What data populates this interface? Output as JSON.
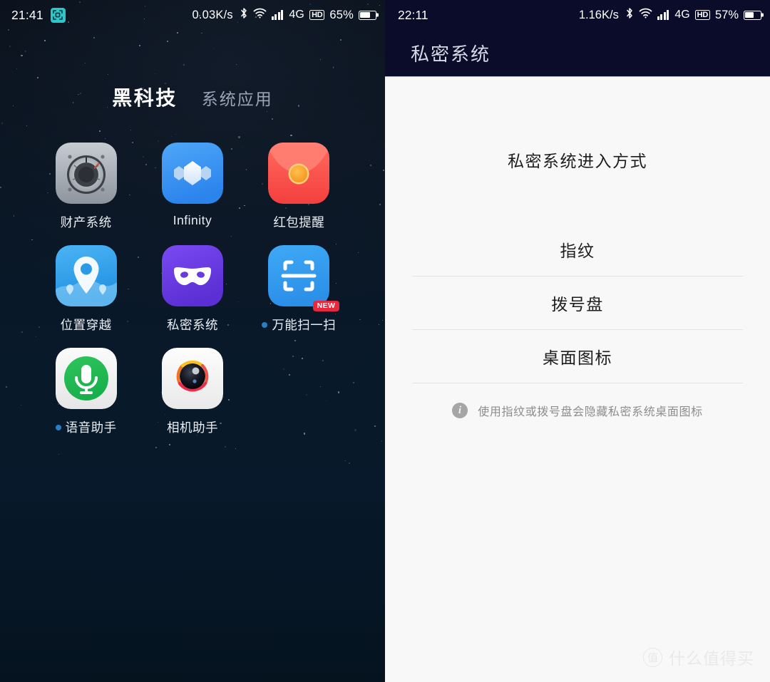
{
  "left_phone": {
    "statusbar": {
      "time": "21:41",
      "screenshot_icon": "screenshot-icon",
      "net_speed": "0.03K/s",
      "bluetooth_icon": "bluetooth-icon",
      "wifi_icon": "wifi-icon",
      "signal_icon": "signal-bars-icon",
      "network": "4G",
      "hd": "HD",
      "battery_pct": "65%",
      "battery_level": 65
    },
    "tabs": [
      {
        "label": "黑科技",
        "active": true
      },
      {
        "label": "系统应用",
        "active": false
      }
    ],
    "apps": [
      {
        "label": "财产系统",
        "icon": "compass-gauge-icon",
        "dot": false,
        "badge": null
      },
      {
        "label": "Infinity",
        "icon": "infinity-hexagon-icon",
        "dot": false,
        "badge": null
      },
      {
        "label": "红包提醒",
        "icon": "red-packet-icon",
        "dot": false,
        "badge": null
      },
      {
        "label": "位置穿越",
        "icon": "location-pin-icon",
        "dot": false,
        "badge": null
      },
      {
        "label": "私密系统",
        "icon": "mask-icon",
        "dot": false,
        "badge": null
      },
      {
        "label": "万能扫一扫",
        "icon": "scan-frame-icon",
        "dot": true,
        "badge": "NEW"
      },
      {
        "label": "语音助手",
        "icon": "microphone-icon",
        "dot": true,
        "badge": null
      },
      {
        "label": "相机助手",
        "icon": "camera-lens-icon",
        "dot": false,
        "badge": null
      }
    ]
  },
  "right_phone": {
    "statusbar": {
      "time": "22:11",
      "net_speed": "1.16K/s",
      "bluetooth_icon": "bluetooth-icon",
      "wifi_icon": "wifi-icon",
      "signal_icon": "signal-bars-icon",
      "network": "4G",
      "hd": "HD",
      "battery_pct": "57%",
      "battery_level": 57
    },
    "header_title": "私密系统",
    "section_title": "私密系统进入方式",
    "options": [
      {
        "label": "指纹"
      },
      {
        "label": "拨号盘"
      },
      {
        "label": "桌面图标"
      }
    ],
    "hint": "使用指纹或拨号盘会隐藏私密系统桌面图标",
    "watermark": {
      "mark": "值",
      "text": "什么值得买"
    }
  },
  "colors": {
    "left_bg_top": "#080e18",
    "left_bg_bottom": "#05131f",
    "accent_teal": "#2ec7c9",
    "badge_red": "#e8283c",
    "dot_blue": "#2a7fc4",
    "right_header_navy": "#0b0b2a",
    "right_bg": "#f8f8f8"
  }
}
